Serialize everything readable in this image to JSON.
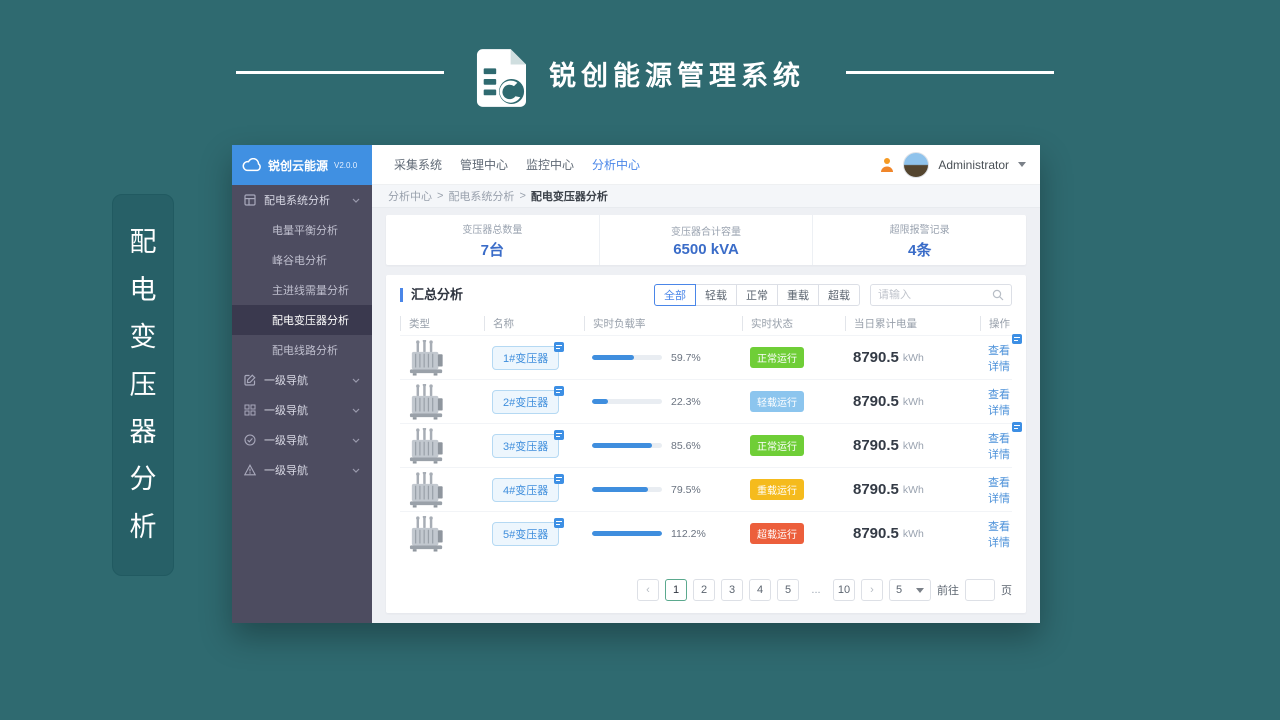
{
  "banner": {
    "title": "锐创能源管理系统"
  },
  "side_label": {
    "chars": [
      "配",
      "电",
      "变",
      "压",
      "器",
      "分",
      "析"
    ]
  },
  "app": {
    "sidebar": {
      "logo": {
        "name": "锐创云能源",
        "version": "V2.0.0"
      },
      "menu": [
        {
          "label": "配电系统分析"
        },
        {
          "label": "电量平衡分析"
        },
        {
          "label": "峰谷电分析"
        },
        {
          "label": "主进线需量分析"
        },
        {
          "label": "配电变压器分析"
        },
        {
          "label": "配电线路分析"
        },
        {
          "label": "一级导航"
        },
        {
          "label": "一级导航"
        },
        {
          "label": "一级导航"
        },
        {
          "label": "一级导航"
        }
      ]
    },
    "topnav": {
      "items": [
        "采集系统",
        "管理中心",
        "监控中心",
        "分析中心"
      ],
      "active": "分析中心",
      "user": "Administrator"
    },
    "breadcrumb": {
      "items": [
        "分析中心",
        "配电系统分析",
        "配电变压器分析"
      ],
      "separator": ">"
    },
    "stats": [
      {
        "label": "变压器总数量",
        "value": "7台"
      },
      {
        "label": "变压器合计容量",
        "value": "6500 kVA"
      },
      {
        "label": "超限报警记录",
        "value": "4条"
      }
    ],
    "summary": {
      "title": "汇总分析",
      "filters": [
        "全部",
        "轻载",
        "正常",
        "重载",
        "超载"
      ],
      "active_filter": "全部",
      "search_placeholder": "请输入"
    },
    "table": {
      "headers": [
        "类型",
        "名称",
        "实时负载率",
        "实时状态",
        "当日累计电量",
        "操作"
      ],
      "rows": [
        {
          "name": "1#变压器",
          "load": "59.7%",
          "load_pct": 59.7,
          "status": "正常运行",
          "status_type": "normal",
          "energy": "8790.5",
          "unit": "kWh",
          "action": "查看详情"
        },
        {
          "name": "2#变压器",
          "load": "22.3%",
          "load_pct": 22.3,
          "status": "轻载运行",
          "status_type": "light",
          "energy": "8790.5",
          "unit": "kWh",
          "action": "查看详情"
        },
        {
          "name": "3#变压器",
          "load": "85.6%",
          "load_pct": 85.6,
          "status": "正常运行",
          "status_type": "normal",
          "energy": "8790.5",
          "unit": "kWh",
          "action": "查看详情"
        },
        {
          "name": "4#变压器",
          "load": "79.5%",
          "load_pct": 79.5,
          "status": "重载运行",
          "status_type": "heavy",
          "energy": "8790.5",
          "unit": "kWh",
          "action": "查看详情"
        },
        {
          "name": "5#变压器",
          "load": "112.2%",
          "load_pct": 112.2,
          "status": "超载运行",
          "status_type": "over",
          "energy": "8790.5",
          "unit": "kWh",
          "action": "查看详情"
        }
      ]
    },
    "pagination": {
      "prev": "‹",
      "pages": [
        "1",
        "2",
        "3",
        "4",
        "5",
        "...",
        "10"
      ],
      "active": "1",
      "next": "›",
      "size": "5",
      "goto_label": "前往",
      "page_unit": "页"
    }
  },
  "icons": {
    "banner_logo": "document-refresh-icon",
    "sidebar_logo": "cloud-icon",
    "user_area": "user-notification-icon",
    "row_image": "transformer-image"
  },
  "colors": {
    "page_teal": "#2f6a70",
    "sidebar_bg": "#4d4c60",
    "logo_bar_blue": "#4090e2",
    "accent_blue": "#4a86e8",
    "stat_value_blue": "#3a6cc8",
    "progress_blue": "#3f8ede",
    "status_normal_green": "#6fce37",
    "status_light_blue": "#8cc5ee",
    "status_heavy_yellow": "#f5bb1d",
    "status_over_red": "#ec5f3c",
    "pagination_active_border": "#5ba98e"
  }
}
